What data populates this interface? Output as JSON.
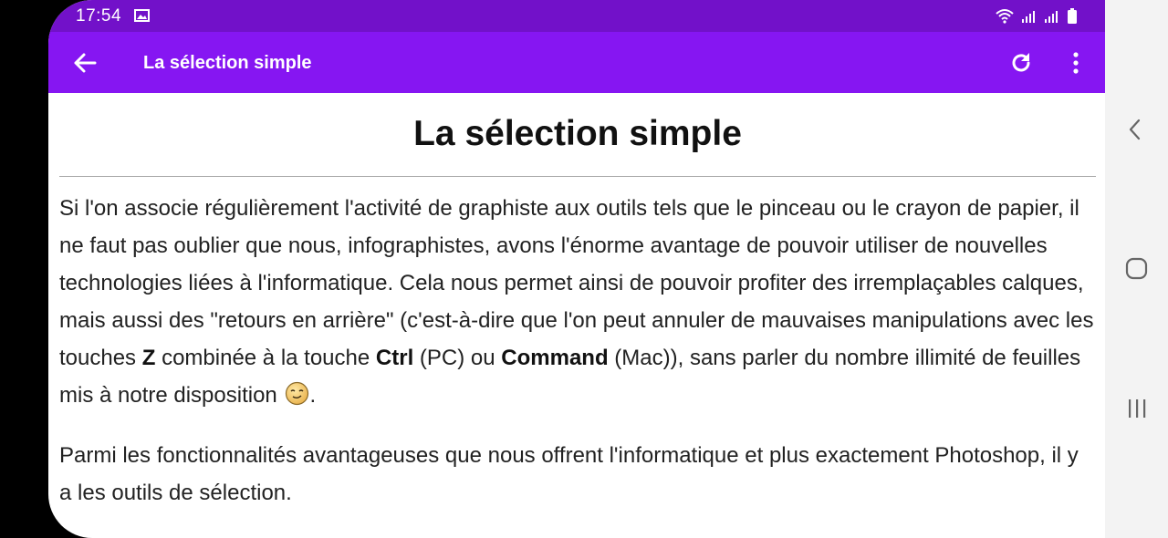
{
  "statusbar": {
    "time": "17:54"
  },
  "appbar": {
    "title": "La sélection simple"
  },
  "article": {
    "title": "La sélection simple",
    "p1": {
      "t1": "Si l'on associe régulièrement l'activité de graphiste aux outils tels que le pinceau ou le crayon de papier, il ne faut pas oublier que nous, infographistes, avons l'énorme avantage de pouvoir utiliser de nouvelles technologies liées à l'informatique. Cela nous permet ainsi de pouvoir profiter des irremplaçables calques, mais aussi des \"retours en arrière\" (c'est-à-dire que l'on peut annuler de mauvaises manipulations avec les touches ",
      "k1": "Z",
      "t2": " combinée à la touche ",
      "k2": "Ctrl",
      "t3": " (PC) ou ",
      "k3": "Command",
      "t4": " (Mac)), sans parler du nombre illimité de feuilles mis à notre disposition ",
      "t5": "."
    },
    "p2": "Parmi les fonctionnalités avantageuses que nous offrent l'informatique et plus exactement Photoshop, il y a les outils de sélection."
  },
  "icons": {
    "back": "arrow-back-icon",
    "refresh": "refresh-icon",
    "more": "more-vertical-icon",
    "smiley": "smiley-icon",
    "nav_back": "chevron-left-icon",
    "nav_home": "home-icon",
    "nav_recents": "recents-icon"
  },
  "colors": {
    "statusbar": "#7211c9",
    "appbar": "#8616f2",
    "text": "#222222",
    "navbar": "#f3f3f3"
  }
}
